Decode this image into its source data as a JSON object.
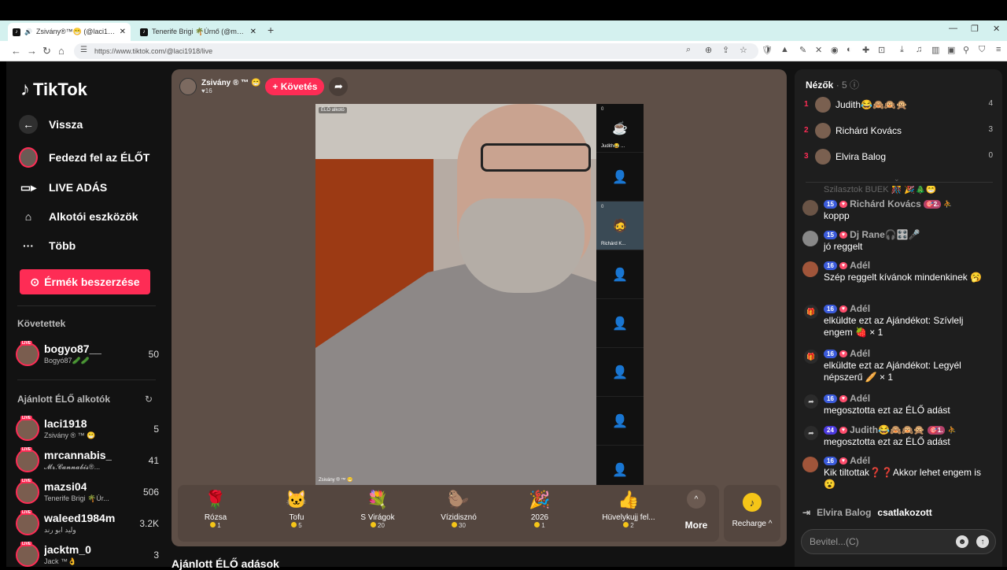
{
  "browser": {
    "tabs": [
      {
        "label": "Zsivány®™😁 (@laci1918) Éi",
        "active": true
      },
      {
        "label": "Tenerife Brigi 🌴Úrnő (@mazsi04) Él",
        "active": false
      }
    ],
    "url": "https://www.tiktok.com/@laci1918/live"
  },
  "sidebar": {
    "logo": "TikTok",
    "back": "Vissza",
    "items": [
      {
        "label": "Fedezd fel az ÉLŐT"
      },
      {
        "label": "LIVE ADÁS"
      },
      {
        "label": "Alkotói eszközök"
      },
      {
        "label": "Több"
      }
    ],
    "coins_button": "Érmék beszerzése",
    "following_title": "Követettek",
    "following": [
      {
        "name": "bogyo87__",
        "sub": "Bogyó87🥒🥒",
        "count": "50"
      }
    ],
    "recommended_title": "Ajánlott ÉLŐ alkotók",
    "recommended": [
      {
        "name": "laci1918",
        "sub": "Zsivány ® ™ 😁",
        "count": "5"
      },
      {
        "name": "mrcannabis_",
        "sub": "𝓜𝓻.𝓒𝓪𝓷𝓷𝓪𝓫𝓲𝓼®...",
        "count": "41"
      },
      {
        "name": "mazsi04",
        "sub": "Tenerife Brigi 🌴Úr...",
        "count": "506"
      },
      {
        "name": "waleed1984m",
        "sub": "وليد ابو رند",
        "count": "3.2K"
      },
      {
        "name": "jacktm_0",
        "sub": "Jack ™👌",
        "count": "3"
      }
    ],
    "live_badge": "LIVE"
  },
  "stream": {
    "host_name": "Zsivány ® ™ 😁",
    "host_likes": "♥16",
    "follow": "+ Követés",
    "video_label": "ÉLŐ alkotó",
    "video_name": "Zsivány ® ™ 😁",
    "guests": [
      {
        "name": "Judith😂 ...",
        "count": "0"
      },
      {
        "name": "",
        "count": ""
      },
      {
        "name": "Richárd K...",
        "count": "0"
      },
      {
        "name": "",
        "count": ""
      },
      {
        "name": "",
        "count": ""
      },
      {
        "name": "",
        "count": ""
      },
      {
        "name": "",
        "count": ""
      },
      {
        "name": "",
        "count": ""
      }
    ]
  },
  "gifts": [
    {
      "icon": "🌹",
      "name": "Rózsa",
      "price": "1"
    },
    {
      "icon": "🐱",
      "name": "Tofu",
      "price": "5"
    },
    {
      "icon": "💐",
      "name": "S Virágok",
      "price": "20"
    },
    {
      "icon": "🦫",
      "name": "Vízidisznó",
      "price": "30"
    },
    {
      "icon": "🎉",
      "name": "2026",
      "price": "1"
    },
    {
      "icon": "👍",
      "name": "Hüvelykujj fel...",
      "price": "2"
    }
  ],
  "more_label": "More",
  "recharge_label": "Recharge ^",
  "bottom_title": "Ajánlott ÉLŐ adások",
  "viewers": {
    "title": "Nézők",
    "count": "· 5",
    "list": [
      {
        "rank": "1",
        "name": "Judith😂🙈🙉🙊",
        "score": "4"
      },
      {
        "rank": "2",
        "name": "Richárd Kovács",
        "score": "3"
      },
      {
        "rank": "3",
        "name": "Elvira Balog",
        "score": "0"
      }
    ]
  },
  "chat": [
    {
      "level": "15",
      "name": "Richárd Kovács",
      "badge": "🎯2.",
      "text": "koppp",
      "gift": false
    },
    {
      "level": "15",
      "name": "Dj Rane🎧🎛️🎤",
      "badge": "",
      "text": "jó reggelt",
      "gift": false
    },
    {
      "level": "16",
      "name": "Adél",
      "badge": "",
      "text": "Szép reggelt kívánok mindenkinek 🥱",
      "gift": false
    },
    {
      "level": "16",
      "name": "Adél",
      "badge": "",
      "text": "elküldte ezt az Ajándékot: Szívlelj engem 🍓 × 1",
      "gift": true
    },
    {
      "level": "16",
      "name": "Adél",
      "badge": "",
      "text": "elküldte ezt az Ajándékot: Legyél népszerű 🥖 × 1",
      "gift": true
    },
    {
      "level": "16",
      "name": "Adél",
      "badge": "",
      "text": "megosztotta ezt az ÉLŐ adást",
      "gift": true
    },
    {
      "level": "24",
      "name": "Judith😂🙈🙉🙊",
      "badge": "🎯1.",
      "text": "megosztotta ezt az ÉLŐ adást",
      "gift": true
    },
    {
      "level": "16",
      "name": "Adél",
      "badge": "",
      "text": "Kik tiltottak❓❓Akkor lehet engem is 😮",
      "gift": false
    }
  ],
  "chat_top_fade": "Szilasztok BUÉK 🎊 🎉🎄😁",
  "join": {
    "name": "Elvira Balog",
    "action": "csatlakozott"
  },
  "input_placeholder": "Bevitel...(C)"
}
